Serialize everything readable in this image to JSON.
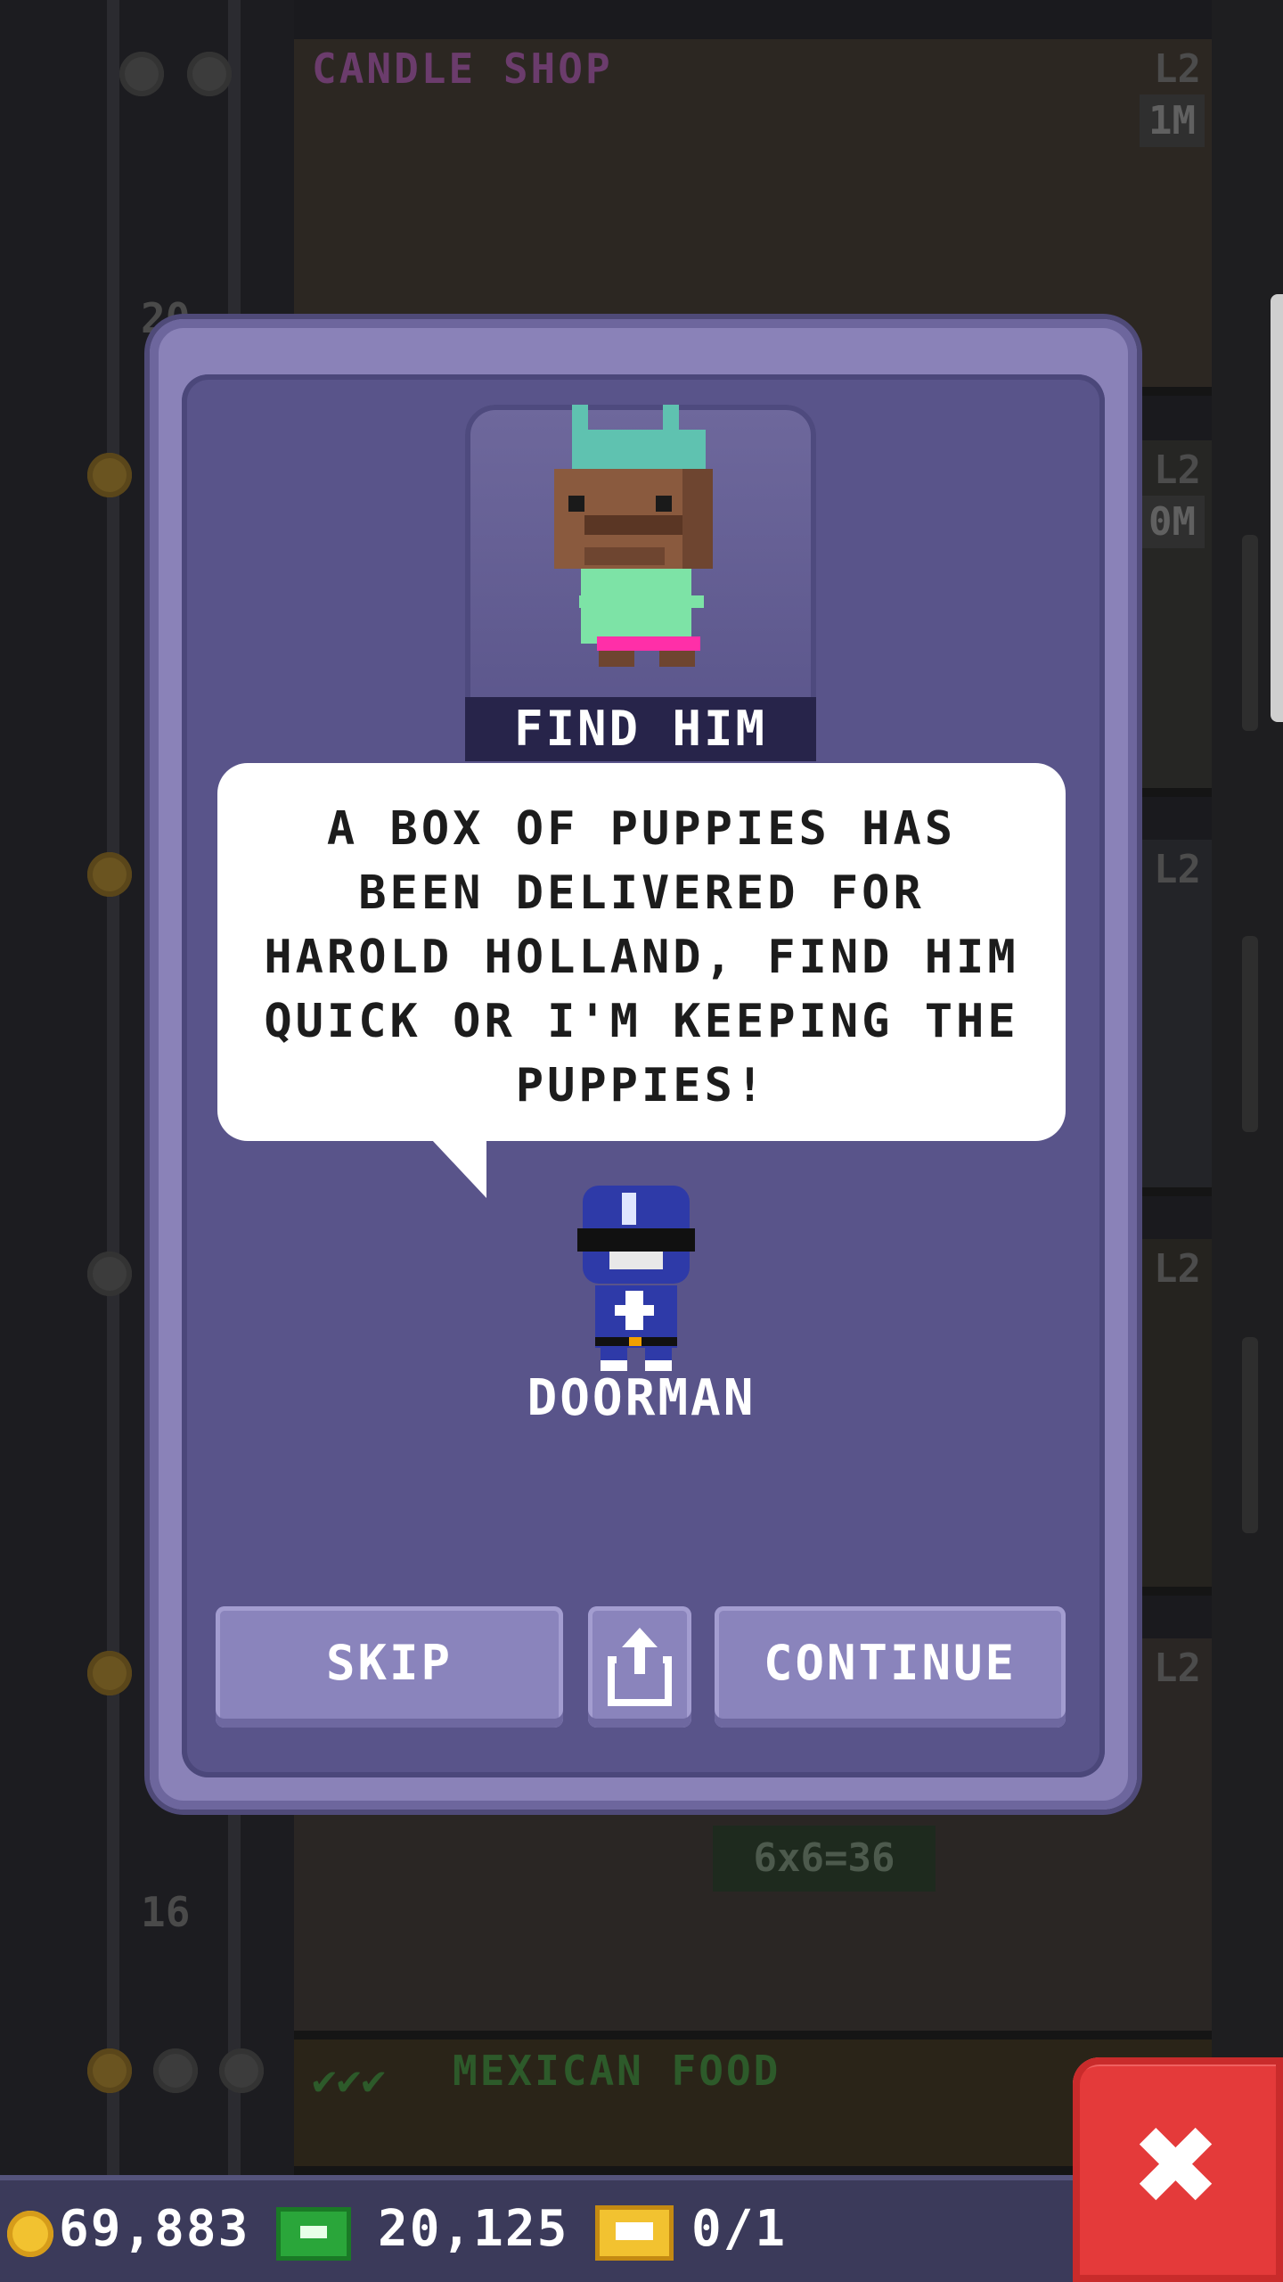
{
  "scene": {
    "floors": [
      {
        "title": "CANDLE SHOP",
        "level": "L2",
        "badge": "1M",
        "title_color": "#6b3c6c"
      },
      {
        "title": "",
        "level": "L2",
        "badge": "0M",
        "title_color": "#5a5a5a"
      },
      {
        "title": "",
        "level": "L2",
        "badge": "",
        "title_color": "#5a5a5a"
      },
      {
        "title": "",
        "level": "L2",
        "badge": "",
        "title_color": "#5a5a5a"
      },
      {
        "title": "",
        "level": "L2",
        "badge": "",
        "title_color": "#5a5a5a"
      },
      {
        "title": "MEXICAN FOOD",
        "level": "",
        "badge": "",
        "title_color": "#2d5a2a"
      }
    ],
    "floor_numbers": [
      "20",
      "16"
    ],
    "chalkboard_text": "6x6=36"
  },
  "dialog": {
    "portrait_character": "guest-with-cat-ears",
    "portrait_tab_label": "FIND HIM",
    "message": "A BOX OF PUPPIES HAS BEEN DELIVERED FOR HAROLD HOLLAND, FIND HIM QUICK OR I'M KEEPING THE PUPPIES!",
    "speaker_character": "blue-ranger-doorman",
    "speaker_label": "DOORMAN",
    "buttons": {
      "skip": "SKIP",
      "share_icon": "share-icon",
      "continue": "CONTINUE"
    },
    "colors": {
      "frame": "#8a82b8",
      "panel": "#59548a",
      "tab": "#27244a",
      "button": "#8a84bc"
    }
  },
  "hud": {
    "coins": "69,883",
    "bux": "20,125",
    "tickets": "0/1",
    "close_icon": "close-icon",
    "close_color": "#e43a3a"
  }
}
